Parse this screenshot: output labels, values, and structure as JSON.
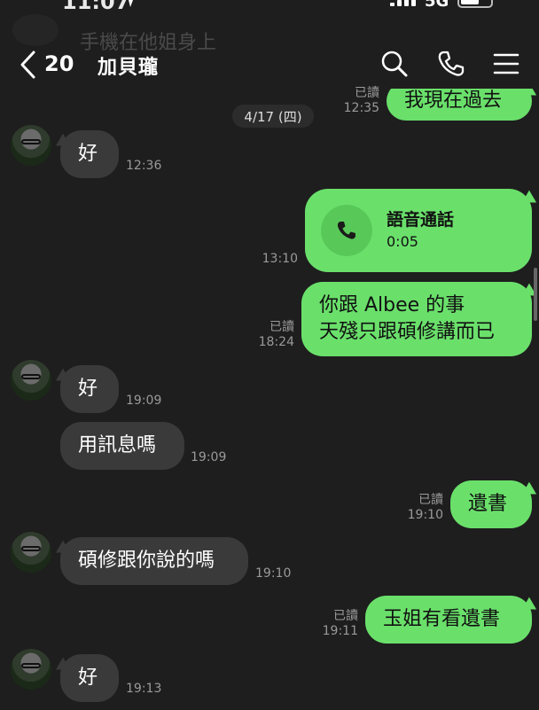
{
  "status_bar": {
    "time": "11:07",
    "network": "5G"
  },
  "notification_ghost": "手機在他姐身上",
  "header": {
    "unread_count": "20",
    "title": "加貝瓏"
  },
  "date_separator": "4/17 (四)",
  "messages": [
    {
      "dir": "out",
      "text": "我現在過去",
      "read": "已讀",
      "time": "12:35"
    },
    {
      "dir": "in",
      "text": "好",
      "time": "12:36"
    },
    {
      "dir": "out",
      "type": "call",
      "title": "語音通話",
      "duration": "0:05",
      "time": "13:10"
    },
    {
      "dir": "out",
      "lines": [
        "你跟 Albee 的事",
        "天殘只跟碩修講而已"
      ],
      "read": "已讀",
      "time": "18:24"
    },
    {
      "dir": "in",
      "text": "好",
      "time": "19:09"
    },
    {
      "dir": "in",
      "text": "用訊息嗎",
      "time": "19:09"
    },
    {
      "dir": "out",
      "text": "遺書",
      "read": "已讀",
      "time": "19:10"
    },
    {
      "dir": "in",
      "text": "碩修跟你說的嗎",
      "time": "19:10"
    },
    {
      "dir": "out",
      "text": "玉姐有看遺書",
      "read": "已讀",
      "time": "19:11"
    },
    {
      "dir": "in",
      "text": "好",
      "time": "19:13"
    }
  ],
  "icons": {
    "back": "chevron-left-icon",
    "search": "search-icon",
    "phone": "phone-icon",
    "menu": "menu-icon",
    "call": "phone-icon"
  },
  "colors": {
    "background": "#1e1e1e",
    "outgoing_bubble": "#6ae06b",
    "incoming_bubble": "#3a3a3a"
  }
}
